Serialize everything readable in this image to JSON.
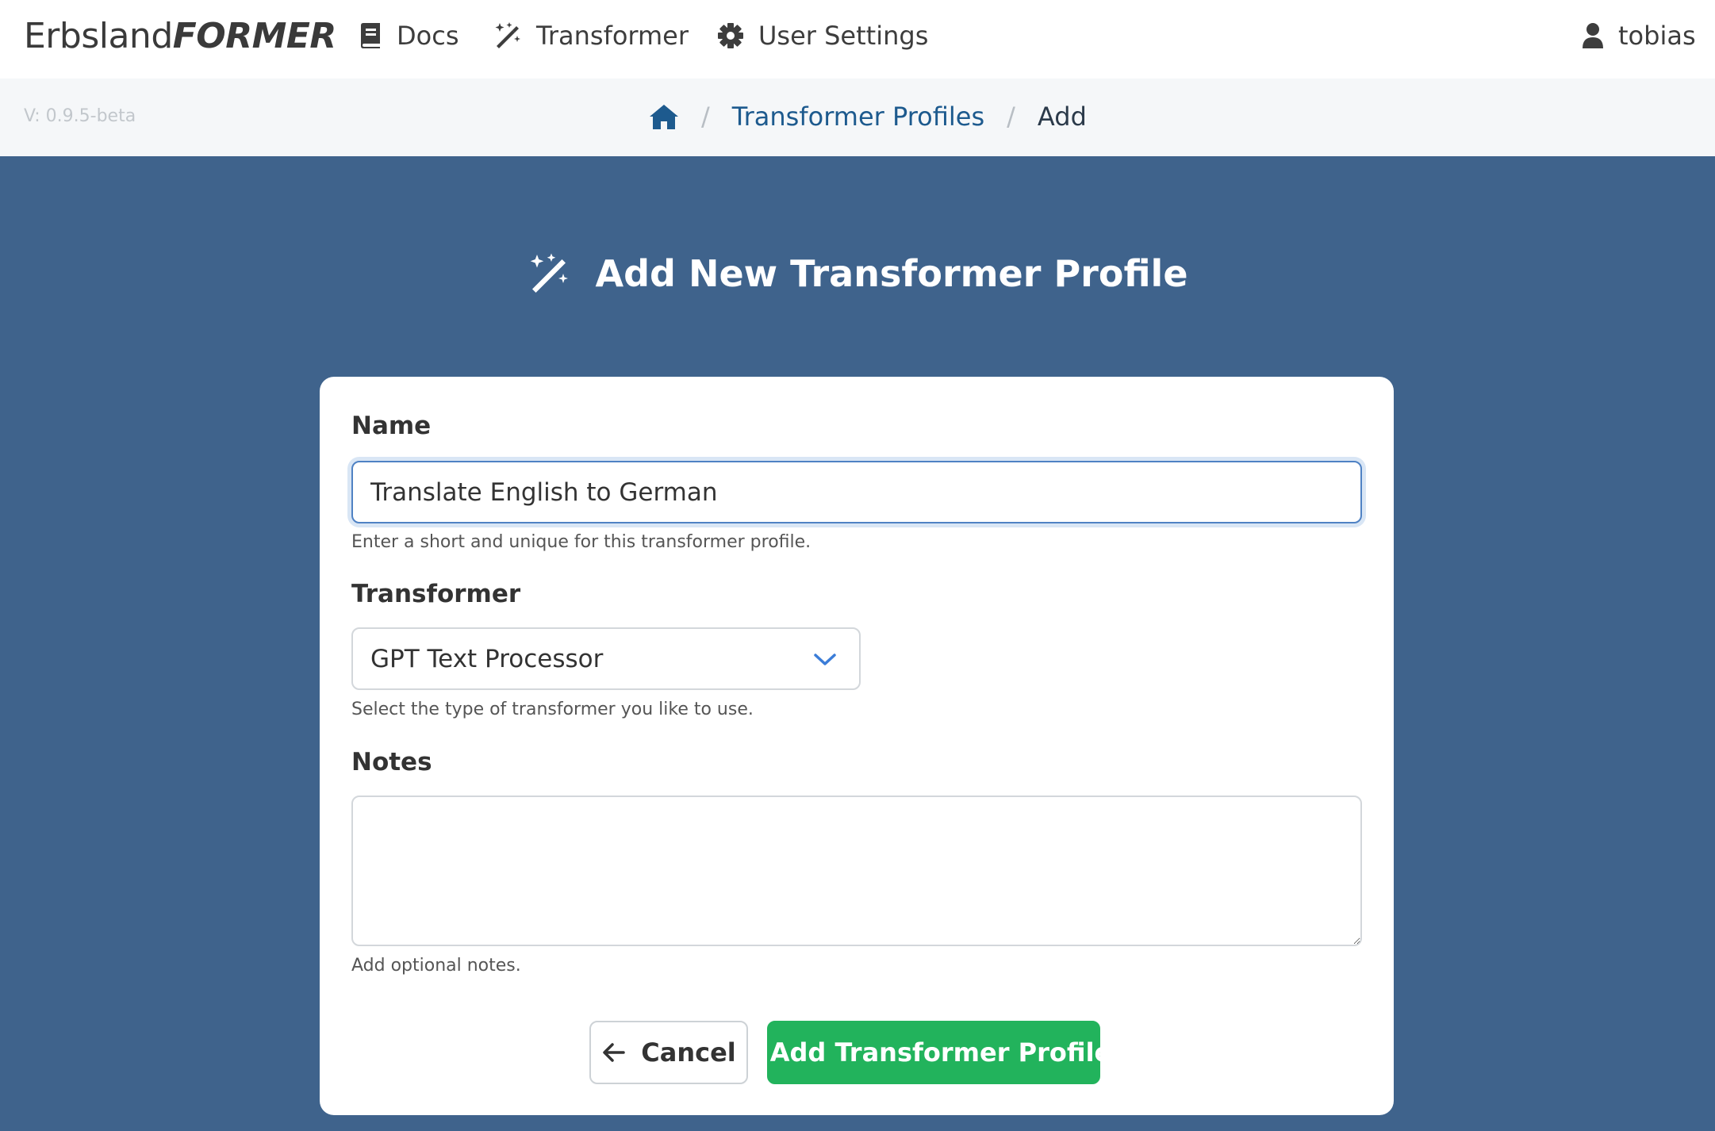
{
  "brand": {
    "prefix": "Erbsland",
    "suffix": "FORMER"
  },
  "nav": {
    "docs": "Docs",
    "transformer": "Transformer",
    "user_settings": "User Settings",
    "user": "tobias"
  },
  "version": "V: 0.9.5-beta",
  "breadcrumb": {
    "separator": "/",
    "items": [
      "Transformer Profiles",
      "Add"
    ]
  },
  "page": {
    "title": "Add New Transformer Profile"
  },
  "form": {
    "name": {
      "label": "Name",
      "value": "Translate English to German",
      "help": "Enter a short and unique for this transformer profile."
    },
    "transformer": {
      "label": "Transformer",
      "selected": "GPT Text Processor",
      "help": "Select the type of transformer you like to use."
    },
    "notes": {
      "label": "Notes",
      "value": "",
      "help": "Add optional notes."
    }
  },
  "actions": {
    "cancel": "Cancel",
    "submit": "Add Transformer Profile"
  },
  "colors": {
    "background": "#3f638c",
    "primary_link": "#1d5a8e",
    "success": "#22b35c",
    "focus_border": "#4f82c4"
  },
  "icons": {
    "docs": "book-icon",
    "transformer": "magic-wand-icon",
    "settings": "gear-icon",
    "user": "user-icon",
    "home": "home-icon",
    "cancel": "arrow-left-icon",
    "submit": "plus-icon",
    "select": "chevron-down-icon"
  }
}
